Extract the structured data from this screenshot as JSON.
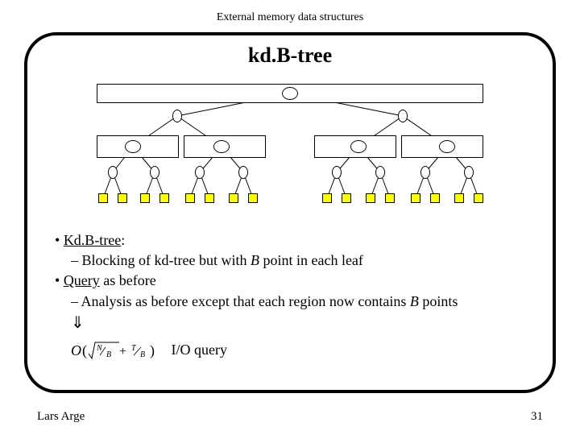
{
  "header": "External memory data structures",
  "title": "kd.B-tree",
  "bullets": {
    "b1_prefix": "• ",
    "b1_label": "Kd.B-tree",
    "b1_suffix": ":",
    "b1_sub_prefix": "– Blocking of kd-tree but with ",
    "b1_sub_var": "B",
    "b1_sub_suffix": " point in each leaf",
    "b2_prefix": "• ",
    "b2_label": "Query",
    "b2_suffix": " as before",
    "b2_sub_prefix": "– Analysis as before except that each region now contains ",
    "b2_sub_var": "B",
    "b2_sub_suffix": " points",
    "arrow": "⇓",
    "io_suffix": "I/O query"
  },
  "footer": {
    "author": "Lars Arge",
    "page": "31"
  }
}
